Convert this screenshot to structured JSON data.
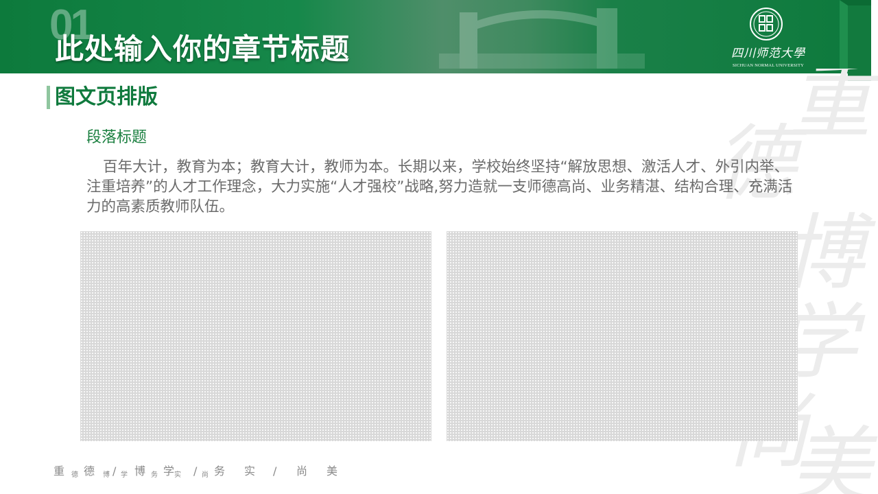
{
  "header": {
    "chapter_number": "01",
    "chapter_title": "此处输入你的章节标题",
    "logo": {
      "cn_name": "四川师范大學",
      "en_name": "SICHUAN NORMAL UNIVERSITY",
      "seal_text": "四川師範大學"
    }
  },
  "section": {
    "title": "图文页排版"
  },
  "content": {
    "paragraph_title": "段落标题",
    "paragraph_body": "百年大计，教育为本；教育大计，教师为本。长期以来，学校始终坚持“解放思想、激活人才、外引内举、注重培养”的人才工作理念，大力实施“人才强校”战略,努力造就一支师德高尚、业务精湛、结构合理、充满活力的高素质教师队伍。"
  },
  "watermark": [
    "重",
    "德",
    "博",
    "学",
    "尚",
    "美"
  ],
  "footer": {
    "motto": [
      {
        "text": "重",
        "size": "big"
      },
      {
        "text": "德",
        "size": "small"
      },
      {
        "text": "德",
        "size": "big"
      },
      {
        "text": "博",
        "size": "small"
      },
      {
        "text": "/",
        "size": "big"
      },
      {
        "text": "学",
        "size": "small"
      },
      {
        "text": "博",
        "size": "big"
      },
      {
        "text": "务",
        "size": "small"
      },
      {
        "text": "学",
        "size": "big"
      },
      {
        "text": "实",
        "size": "small"
      },
      {
        "text": "/",
        "size": "big"
      },
      {
        "text": "尚",
        "size": "small"
      },
      {
        "text": "务",
        "size": "big"
      },
      {
        "text": "实",
        "size": "big"
      },
      {
        "text": "/",
        "size": "big"
      },
      {
        "text": "尚",
        "size": "big"
      },
      {
        "text": "美",
        "size": "big"
      }
    ]
  },
  "colors": {
    "brand_green": "#0f7a3d",
    "accent_bar": "#8fc69f",
    "body_text": "#6b6b6b"
  }
}
